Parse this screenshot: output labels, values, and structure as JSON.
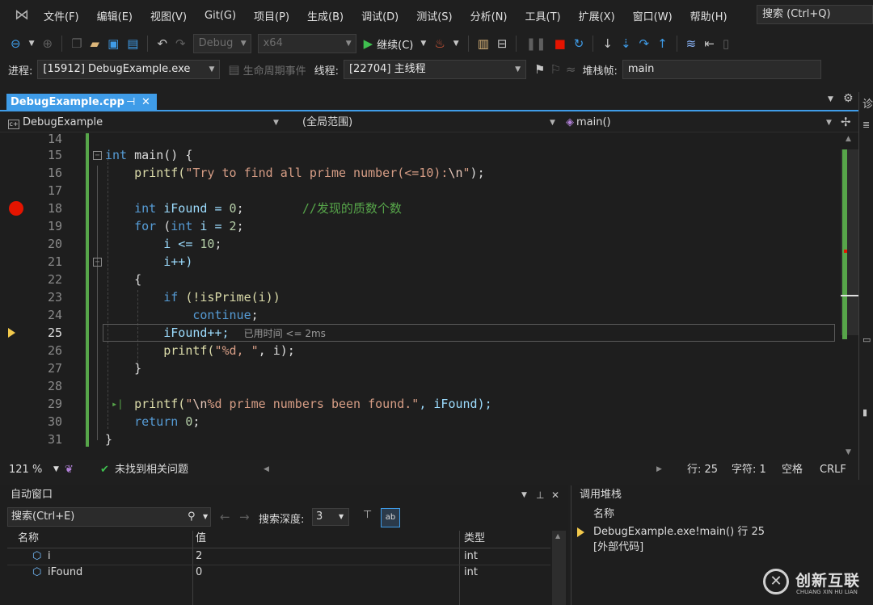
{
  "menu": {
    "items": [
      "文件(F)",
      "编辑(E)",
      "视图(V)",
      "Git(G)",
      "项目(P)",
      "生成(B)",
      "调试(D)",
      "测试(S)",
      "分析(N)",
      "工具(T)",
      "扩展(X)",
      "窗口(W)",
      "帮助(H)"
    ],
    "search_label": "搜索 (Ctrl+Q)"
  },
  "toolbar": {
    "config": "Debug",
    "platform": "x64",
    "continue_label": "继续(C)"
  },
  "debugbar": {
    "process_label": "进程:",
    "process_value": "[15912] DebugExample.exe",
    "lifecycle_label": "生命周期事件",
    "thread_label": "线程:",
    "thread_value": "[22704] 主线程",
    "stackframe_label": "堆栈帧:",
    "stackframe_value": "main"
  },
  "tab": {
    "title": "DebugExample.cpp",
    "pin": "⊣",
    "close": "✕"
  },
  "navbar": {
    "project": "DebugExample",
    "scope": "(全局范围)",
    "member": "main()"
  },
  "editor": {
    "line_numbers": [
      "14",
      "15",
      "16",
      "17",
      "18",
      "19",
      "20",
      "21",
      "22",
      "23",
      "24",
      "25",
      "26",
      "27",
      "28",
      "29",
      "30",
      "31"
    ],
    "breakpoint_line": "18",
    "current_line": "25",
    "elapsed_hint": "已用时间 <= 2ms",
    "code": {
      "l15_a": "int",
      "l15_b": " main() {",
      "l16_a": "    printf(",
      "l16_b": "\"Try to find all prime number(<=10):",
      "l16_c": "\\n",
      "l16_d": "\"",
      "l16_e": ");",
      "l18_a": "    ",
      "l18_b": "int",
      "l18_c": " iFound = ",
      "l18_d": "0",
      "l18_e": ";        ",
      "l18_f": "//发现的质数个数",
      "l19_a": "    ",
      "l19_b": "for",
      "l19_c": " (",
      "l19_d": "int",
      "l19_e": " i = ",
      "l19_f": "2",
      "l19_g": ";",
      "l20_a": "        i <= ",
      "l20_b": "10",
      "l20_c": ";",
      "l21": "        i++)",
      "l22": "    {",
      "l23_a": "        ",
      "l23_b": "if",
      "l23_c": " (!isPrime(i))",
      "l24_a": "            ",
      "l24_b": "continue",
      "l24_c": ";",
      "l25": "        iFound++;  ",
      "l26_a": "        printf(",
      "l26_b": "\"%d, \"",
      "l26_c": ", i);",
      "l27": "    }",
      "l29_a": "    printf(",
      "l29_b": "\"",
      "l29_c": "\\n",
      "l29_d": "%d prime numbers been found.\"",
      "l29_e": ", iFound);",
      "l30_a": "    ",
      "l30_b": "return",
      "l30_c": " ",
      "l30_d": "0",
      "l30_e": ";",
      "l31": "}"
    }
  },
  "status": {
    "zoom": "121 %",
    "issues": "未找到相关问题",
    "line": "行: 25",
    "col": "字符: 1",
    "spacing": "空格",
    "eol": "CRLF"
  },
  "autos": {
    "title": "自动窗口",
    "search_placeholder": "搜索(Ctrl+E)",
    "depth_label": "搜索深度:",
    "depth_value": "3",
    "columns": [
      "名称",
      "值",
      "类型"
    ],
    "rows": [
      {
        "name": "i",
        "value": "2",
        "type": "int"
      },
      {
        "name": "iFound",
        "value": "0",
        "type": "int"
      }
    ]
  },
  "callstack": {
    "title": "调用堆栈",
    "column": "名称",
    "frames": [
      "DebugExample.exe!main() 行 25",
      "[外部代码]"
    ]
  },
  "watermark": {
    "cn": "创新互联",
    "en": "CHUANG XIN HU LIAN"
  },
  "colors": {
    "accent": "#3f9ce8",
    "breakpoint": "#e51400",
    "changed_bar": "#57a64a",
    "current_arrow": "#f2c94c"
  }
}
